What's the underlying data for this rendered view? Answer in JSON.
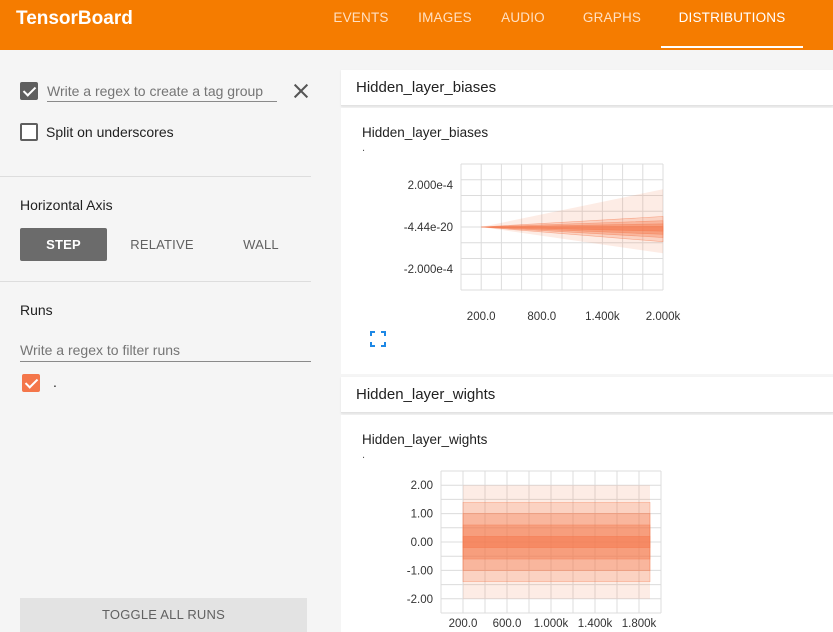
{
  "app": {
    "title": "TensorBoard"
  },
  "nav": {
    "tabs": [
      {
        "label": "EVENTS"
      },
      {
        "label": "IMAGES"
      },
      {
        "label": "AUDIO"
      },
      {
        "label": "GRAPHS"
      },
      {
        "label": "DISTRIBUTIONS",
        "active": true
      }
    ]
  },
  "sidebar": {
    "tag_group_regex": {
      "checked": true,
      "placeholder": "Write a regex to create a tag group",
      "value": ""
    },
    "split_on_underscores": {
      "label": "Split on underscores",
      "checked": false
    },
    "horizontal_axis": {
      "title": "Horizontal Axis",
      "options": [
        {
          "label": "STEP",
          "active": true
        },
        {
          "label": "RELATIVE"
        },
        {
          "label": "WALL"
        }
      ]
    },
    "runs": {
      "title": "Runs",
      "filter_placeholder": "Write a regex to filter runs",
      "items": [
        {
          "label": ".",
          "checked": true,
          "color": "#f4764a"
        }
      ]
    },
    "toggle_all_label": "TOGGLE ALL RUNS"
  },
  "colors": {
    "accent": "#f57c00",
    "run": "#f4764a"
  },
  "cards": [
    {
      "header": "Hidden_layer_biases",
      "chart_title": "Hidden_layer_biases",
      "run_label": ".",
      "fit_icon": "fit-to-domain-icon"
    },
    {
      "header": "Hidden_layer_wights",
      "chart_title": "Hidden_layer_wights",
      "run_label": "."
    }
  ],
  "chart_data": [
    {
      "type": "area",
      "title": "Hidden_layer_biases",
      "x_ticks": [
        "200.0",
        "800.0",
        "1.400k",
        "2.000k"
      ],
      "y_ticks": [
        "2.000e-4",
        "-4.44e-20",
        "-2.000e-4"
      ],
      "xlim": [
        0,
        2000
      ],
      "ylim": [
        -0.0003,
        0.0003
      ],
      "grid": true,
      "x": [
        200,
        2000
      ],
      "bands": [
        {
          "lower": [
            0,
            -0.000125
          ],
          "upper": [
            0,
            0.00018
          ]
        },
        {
          "lower": [
            0,
            -7e-05
          ],
          "upper": [
            0,
            5e-05
          ]
        },
        {
          "lower": [
            0,
            -5e-05
          ],
          "upper": [
            0,
            3e-05
          ]
        },
        {
          "lower": [
            0,
            -3.5e-05
          ],
          "upper": [
            0,
            1.5e-05
          ]
        },
        {
          "lower": [
            0,
            -2e-05
          ],
          "upper": [
            0,
            3e-06
          ]
        }
      ]
    },
    {
      "type": "area",
      "title": "Hidden_layer_wights",
      "x_ticks": [
        "200.0",
        "600.0",
        "1.000k",
        "1.400k",
        "1.800k"
      ],
      "y_ticks": [
        "2.00",
        "1.00",
        "0.00",
        "-1.00",
        "-2.00"
      ],
      "xlim": [
        0,
        2000
      ],
      "ylim": [
        -2.5,
        2.5
      ],
      "grid": true,
      "x": [
        200,
        1900
      ],
      "bands": [
        {
          "lower": [
            -2.0,
            -2.0
          ],
          "upper": [
            2.0,
            2.0
          ]
        },
        {
          "lower": [
            -1.4,
            -1.4
          ],
          "upper": [
            1.4,
            1.4
          ]
        },
        {
          "lower": [
            -1.0,
            -1.0
          ],
          "upper": [
            1.0,
            1.0
          ]
        },
        {
          "lower": [
            -0.6,
            -0.6
          ],
          "upper": [
            0.6,
            0.6
          ]
        },
        {
          "lower": [
            -0.2,
            -0.2
          ],
          "upper": [
            0.2,
            0.2
          ]
        }
      ]
    }
  ]
}
